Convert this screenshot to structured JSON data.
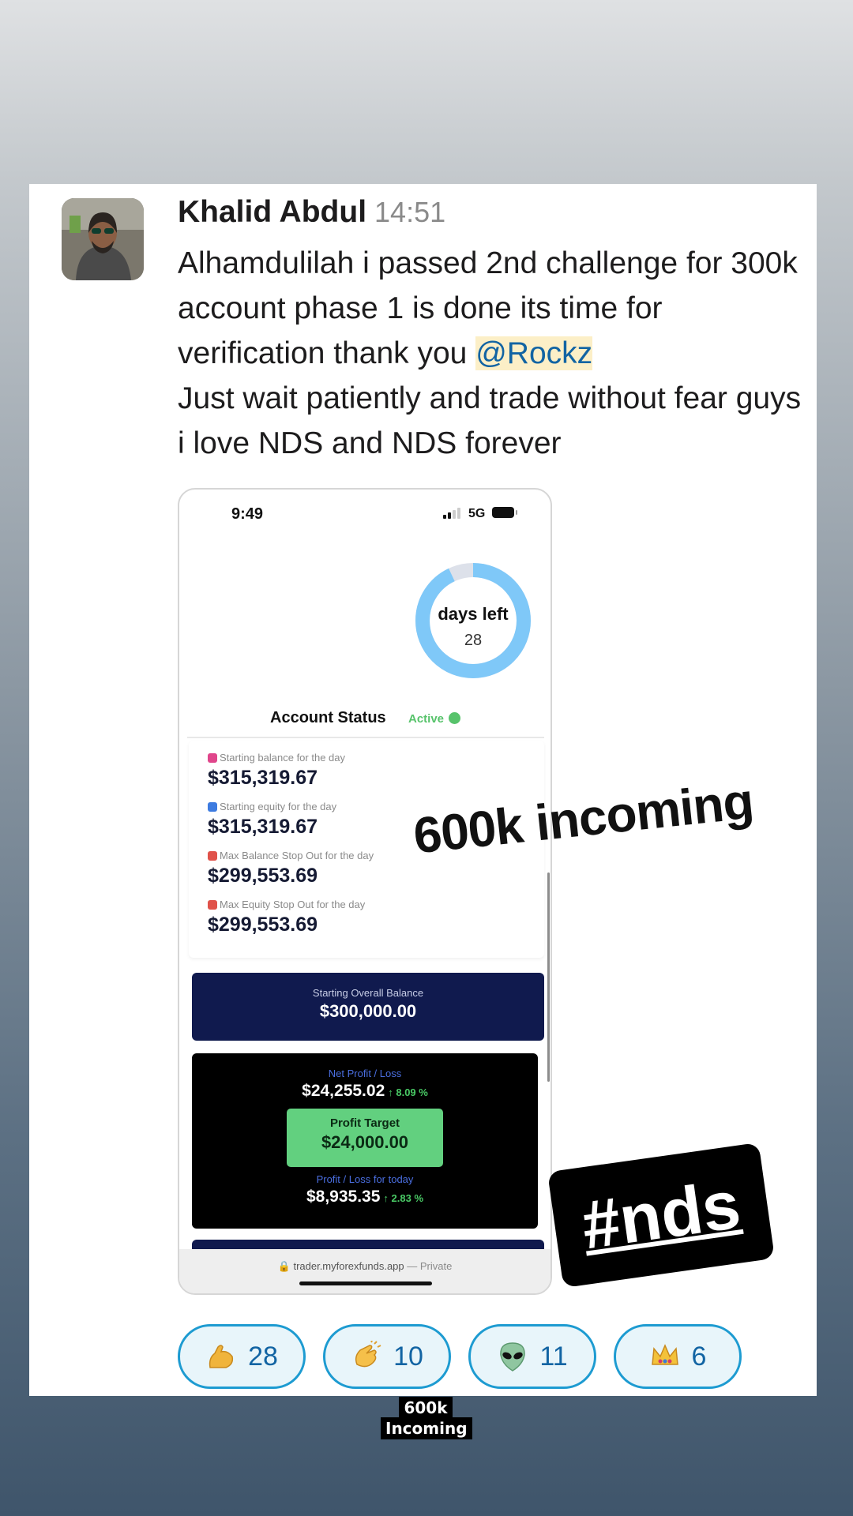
{
  "message": {
    "author": "Khalid Abdul",
    "time": "14:51",
    "text_before_mention": "Alhamdulilah i passed 2nd challenge for 300k account phase 1 is done its time for verification thank you ",
    "mention": "@Rockz",
    "text_after_mention": "Just wait patiently and trade without fear guys i love NDS and NDS forever"
  },
  "phone": {
    "status_time": "9:49",
    "network": "5G",
    "donut": {
      "label": "days left",
      "value": "28",
      "fraction_remaining": 0.93
    },
    "account_status": {
      "title": "Account Status",
      "badge": "Active"
    },
    "metrics": [
      {
        "label": "Starting balance for the day",
        "value": "$315,319.67",
        "color": "#e0468b"
      },
      {
        "label": "Starting equity for the day",
        "value": "$315,319.67",
        "color": "#3d7be0"
      },
      {
        "label": "Max Balance Stop Out for the day",
        "value": "$299,553.69",
        "color": "#e0524a"
      },
      {
        "label": "Max Equity Stop Out for the day",
        "value": "$299,553.69",
        "color": "#e0524a"
      }
    ],
    "overall": {
      "label": "Starting Overall Balance",
      "value": "$300,000.00"
    },
    "net_profit": {
      "label": "Net Profit / Loss",
      "value": "$24,255.02",
      "change": "↑ 8.09 %"
    },
    "profit_target": {
      "label": "Profit Target",
      "value": "$24,000.00"
    },
    "today": {
      "label": "Profit / Loss for today",
      "value": "$8,935.35",
      "change": "↑ 2.83 %"
    },
    "url": {
      "domain": "trader.myforexfunds.app",
      "separator": " — ",
      "private": "Private"
    }
  },
  "reactions": [
    {
      "icon": "flexed-biceps-icon",
      "count": "28"
    },
    {
      "icon": "clapping-hands-icon",
      "count": "10"
    },
    {
      "icon": "alien-icon",
      "count": "11"
    },
    {
      "icon": "crown-icon",
      "count": "6"
    }
  ],
  "stickers": {
    "incoming": "600k incoming",
    "hashtag": "#nds",
    "bottom_line1": "600k",
    "bottom_line2": "Incoming"
  },
  "colors": {
    "mention": "#1264a3",
    "mention_bg": "#fcefc7",
    "reaction_border": "#1d9bd1",
    "active_green": "#57c36b",
    "donut_blue": "#7fc8f8",
    "navy": "#101a4e",
    "target_green": "#62d07f"
  }
}
